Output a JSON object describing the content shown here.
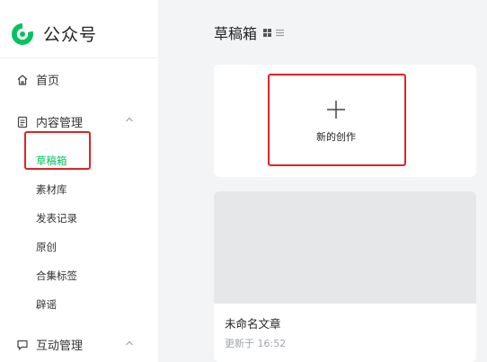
{
  "app": {
    "name": "公众号"
  },
  "sidebar": {
    "home": {
      "label": "首页",
      "icon": "home-icon"
    },
    "content": {
      "label": "内容管理",
      "icon": "document-icon",
      "expanded": true,
      "items": [
        {
          "label": "草稿箱",
          "active": true
        },
        {
          "label": "素材库"
        },
        {
          "label": "发表记录"
        },
        {
          "label": "原创"
        },
        {
          "label": "合集标签"
        },
        {
          "label": "辟谣"
        }
      ]
    },
    "interaction": {
      "label": "互动管理",
      "icon": "message-icon"
    }
  },
  "main": {
    "title": "草稿箱",
    "new_card": {
      "label": "新的创作"
    },
    "drafts": [
      {
        "title": "未命名文章",
        "meta": "更新于 16:52"
      }
    ]
  },
  "colors": {
    "accent": "#07c160",
    "highlight": "#e02424",
    "background": "#f3f4f6"
  }
}
